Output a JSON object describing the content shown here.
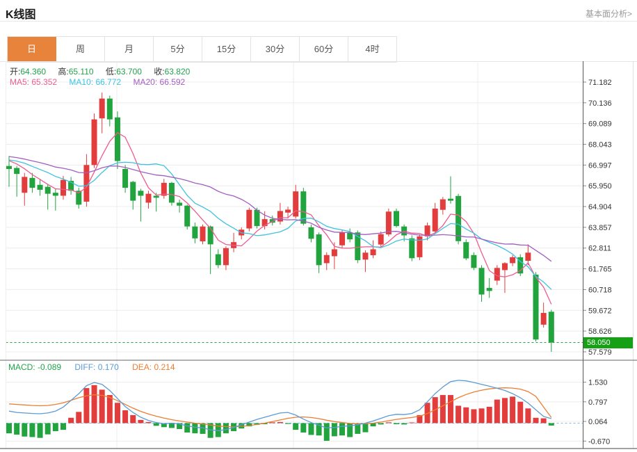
{
  "header": {
    "title": "K线图",
    "link": "基本面分析>"
  },
  "tabs": {
    "items": [
      "日",
      "周",
      "月",
      "5分",
      "15分",
      "30分",
      "60分",
      "4时"
    ],
    "active": "日"
  },
  "main_legend": {
    "ohlc": [
      {
        "label": "开:",
        "value": "64.360"
      },
      {
        "label": "高:",
        "value": "65.110"
      },
      {
        "label": "低:",
        "value": "63.700"
      },
      {
        "label": "收:",
        "value": "63.820"
      }
    ],
    "ma": [
      {
        "label": "MA5:",
        "value": "65.352"
      },
      {
        "label": "MA10:",
        "value": "66.772"
      },
      {
        "label": "MA20:",
        "value": "66.592"
      }
    ]
  },
  "macd_legend": [
    {
      "label": "MACD:",
      "value": "-0.089"
    },
    {
      "label": "DIFF:",
      "value": "0.170"
    },
    {
      "label": "DEA:",
      "value": "0.214"
    }
  ],
  "price_label": "58.050",
  "colors": {
    "up": "#e23c3c",
    "down": "#21a33e",
    "ma5": "#ee5c8d",
    "ma10": "#3ec2e0",
    "ma20": "#a25ec0",
    "diff": "#5b9bd5",
    "dea": "#ed7d31",
    "price_line": "#21a33e",
    "price_tag_bg": "#16a016",
    "tab_active_bg": "#e8833c",
    "grid": "#ececec",
    "axis": "#555555",
    "tick_text": "#333333",
    "zero_dash": "#85b7e2"
  },
  "chart_data": {
    "type": "candlestick",
    "panels": [
      {
        "name": "price",
        "y_ticks": [
          71.182,
          70.136,
          69.089,
          68.043,
          66.997,
          65.95,
          64.904,
          63.857,
          62.811,
          61.765,
          60.718,
          59.672,
          58.626,
          57.579
        ],
        "current_price": 58.05,
        "ma_periods": [
          5,
          10,
          20
        ],
        "ma_warmup": [
          67.8,
          67.6,
          67.9,
          67.7,
          67.5,
          67.6,
          67.8,
          67.5,
          67.4,
          67.6,
          67.3,
          67.2,
          67.4,
          67.5,
          67.3,
          67.1,
          67.4,
          67.6,
          67.3,
          67.0
        ],
        "candles": [
          [
            66.95,
            67.45,
            65.9,
            66.8
          ],
          [
            66.85,
            66.95,
            65.4,
            66.55
          ],
          [
            65.6,
            66.6,
            64.95,
            66.4
          ],
          [
            66.35,
            66.6,
            65.6,
            65.85
          ],
          [
            66.0,
            66.3,
            65.45,
            65.75
          ],
          [
            65.9,
            66.05,
            64.75,
            65.55
          ],
          [
            65.6,
            65.8,
            64.7,
            65.45
          ],
          [
            65.45,
            66.45,
            65.25,
            66.25
          ],
          [
            66.2,
            66.4,
            65.5,
            65.7
          ],
          [
            65.7,
            65.85,
            64.8,
            65.0
          ],
          [
            65.15,
            67.55,
            64.9,
            67.0
          ],
          [
            67.0,
            69.6,
            66.85,
            69.3
          ],
          [
            69.35,
            70.65,
            68.6,
            70.35
          ],
          [
            70.35,
            70.5,
            68.95,
            69.3
          ],
          [
            69.4,
            69.7,
            66.8,
            67.2
          ],
          [
            66.8,
            67.0,
            65.6,
            65.85
          ],
          [
            66.15,
            66.2,
            64.75,
            65.2
          ],
          [
            65.7,
            65.8,
            64.15,
            65.45
          ],
          [
            65.1,
            65.7,
            64.8,
            65.55
          ],
          [
            65.45,
            65.6,
            64.65,
            65.35
          ],
          [
            65.45,
            66.3,
            65.3,
            66.1
          ],
          [
            66.1,
            66.15,
            64.95,
            65.1
          ],
          [
            65.1,
            65.25,
            64.6,
            64.95
          ],
          [
            64.95,
            65.0,
            63.75,
            63.9
          ],
          [
            63.9,
            64.1,
            63.05,
            63.3
          ],
          [
            63.15,
            64.0,
            63.0,
            63.9
          ],
          [
            63.9,
            63.95,
            61.5,
            63.0
          ],
          [
            62.5,
            62.75,
            61.8,
            61.95
          ],
          [
            61.95,
            62.9,
            61.7,
            62.81
          ],
          [
            62.81,
            63.58,
            62.6,
            63.11
          ],
          [
            63.45,
            63.85,
            63.25,
            63.74
          ],
          [
            63.8,
            64.85,
            63.65,
            64.74
          ],
          [
            64.74,
            64.85,
            63.8,
            63.92
          ],
          [
            63.92,
            64.67,
            63.75,
            64.27
          ],
          [
            64.27,
            64.45,
            63.95,
            64.09
          ],
          [
            64.15,
            65.09,
            64.0,
            64.68
          ],
          [
            64.6,
            64.9,
            64.3,
            64.75
          ],
          [
            64.4,
            66.0,
            64.3,
            65.67
          ],
          [
            65.67,
            65.85,
            63.95,
            64.04
          ],
          [
            63.86,
            64.0,
            63.1,
            63.28
          ],
          [
            63.5,
            63.6,
            61.55,
            61.95
          ],
          [
            62.05,
            62.6,
            61.7,
            62.46
          ],
          [
            62.4,
            63.1,
            61.75,
            62.75
          ],
          [
            62.95,
            63.75,
            62.8,
            63.6
          ],
          [
            63.6,
            63.8,
            63.1,
            63.25
          ],
          [
            63.6,
            63.7,
            62.05,
            62.2
          ],
          [
            62.23,
            62.7,
            61.6,
            62.58
          ],
          [
            62.45,
            63.2,
            62.3,
            62.75
          ],
          [
            62.99,
            63.65,
            62.85,
            63.51
          ],
          [
            63.5,
            64.8,
            63.4,
            64.65
          ],
          [
            64.68,
            64.8,
            63.85,
            63.92
          ],
          [
            63.9,
            64.0,
            63.15,
            63.45
          ],
          [
            63.3,
            63.45,
            62.15,
            62.3
          ],
          [
            62.35,
            63.5,
            62.2,
            63.4
          ],
          [
            63.4,
            64.1,
            63.2,
            63.95
          ],
          [
            63.65,
            65.09,
            63.55,
            64.8
          ],
          [
            64.74,
            65.39,
            64.5,
            65.27
          ],
          [
            65.3,
            66.43,
            65.05,
            65.2
          ],
          [
            65.44,
            65.55,
            63.0,
            63.16
          ],
          [
            63.11,
            63.25,
            62.2,
            62.29
          ],
          [
            62.46,
            62.6,
            61.7,
            61.81
          ],
          [
            61.81,
            61.95,
            60.1,
            60.47
          ],
          [
            60.8,
            61.3,
            60.3,
            60.65
          ],
          [
            61.17,
            61.95,
            60.95,
            61.81
          ],
          [
            61.7,
            62.1,
            60.55,
            62.05
          ],
          [
            62.05,
            62.45,
            61.9,
            62.35
          ],
          [
            62.35,
            62.5,
            61.4,
            61.53
          ],
          [
            62.17,
            63.0,
            61.95,
            62.58
          ],
          [
            61.47,
            61.6,
            58.1,
            58.2
          ],
          [
            58.95,
            60.06,
            58.8,
            59.54
          ],
          [
            59.6,
            59.7,
            57.58,
            58.05
          ]
        ]
      },
      {
        "name": "macd",
        "y_ticks": [
          1.53,
          0.797,
          0.064,
          -0.67
        ],
        "hist": [
          -0.38,
          -0.43,
          -0.5,
          -0.52,
          -0.55,
          -0.42,
          -0.3,
          -0.25,
          0.2,
          0.42,
          1.31,
          1.42,
          1.25,
          1.05,
          0.76,
          0.48,
          0.3,
          0.12,
          0.04,
          -0.1,
          -0.15,
          -0.18,
          -0.22,
          -0.35,
          -0.38,
          -0.4,
          -0.55,
          -0.52,
          -0.38,
          -0.3,
          -0.2,
          -0.12,
          -0.06,
          -0.04,
          0.03,
          0.04,
          -0.03,
          -0.25,
          -0.35,
          -0.44,
          -0.46,
          -0.66,
          -0.49,
          -0.46,
          -0.52,
          -0.4,
          -0.34,
          -0.12,
          -0.05,
          0.03,
          -0.04,
          -0.05,
          0.02,
          0.3,
          0.76,
          0.97,
          1.05,
          1.05,
          0.65,
          0.59,
          0.52,
          0.55,
          0.61,
          0.88,
          0.94,
          0.99,
          0.8,
          0.55,
          0.2,
          0.18,
          -0.09
        ],
        "diff": [
          0.45,
          0.4,
          0.38,
          0.36,
          0.35,
          0.38,
          0.45,
          0.6,
          0.85,
          1.1,
          1.4,
          1.52,
          1.45,
          1.22,
          0.92,
          0.62,
          0.4,
          0.22,
          0.1,
          0.02,
          -0.02,
          0.0,
          -0.03,
          -0.1,
          -0.15,
          -0.18,
          -0.25,
          -0.28,
          -0.24,
          -0.16,
          -0.06,
          0.04,
          0.14,
          0.22,
          0.3,
          0.38,
          0.4,
          0.3,
          0.15,
          0.02,
          -0.08,
          -0.18,
          -0.16,
          -0.12,
          -0.1,
          -0.06,
          0.0,
          0.08,
          0.18,
          0.28,
          0.33,
          0.32,
          0.36,
          0.5,
          0.8,
          1.1,
          1.35,
          1.55,
          1.6,
          1.58,
          1.52,
          1.45,
          1.38,
          1.3,
          1.22,
          1.1,
          0.95,
          0.75,
          0.5,
          0.25,
          0.17
        ],
        "dea": [
          0.72,
          0.7,
          0.68,
          0.66,
          0.65,
          0.66,
          0.7,
          0.76,
          0.85,
          0.95,
          1.02,
          1.06,
          1.04,
          0.96,
          0.84,
          0.7,
          0.56,
          0.44,
          0.34,
          0.26,
          0.19,
          0.13,
          0.08,
          0.04,
          0.0,
          -0.03,
          -0.07,
          -0.11,
          -0.13,
          -0.14,
          -0.12,
          -0.09,
          -0.05,
          0.0,
          0.06,
          0.12,
          0.18,
          0.22,
          0.23,
          0.21,
          0.17,
          0.11,
          0.06,
          0.02,
          -0.01,
          -0.02,
          -0.02,
          0.0,
          0.04,
          0.09,
          0.14,
          0.18,
          0.21,
          0.26,
          0.36,
          0.5,
          0.65,
          0.8,
          0.95,
          1.07,
          1.16,
          1.23,
          1.28,
          1.31,
          1.32,
          1.31,
          1.27,
          1.18,
          1.0,
          0.6,
          0.21
        ]
      }
    ]
  }
}
